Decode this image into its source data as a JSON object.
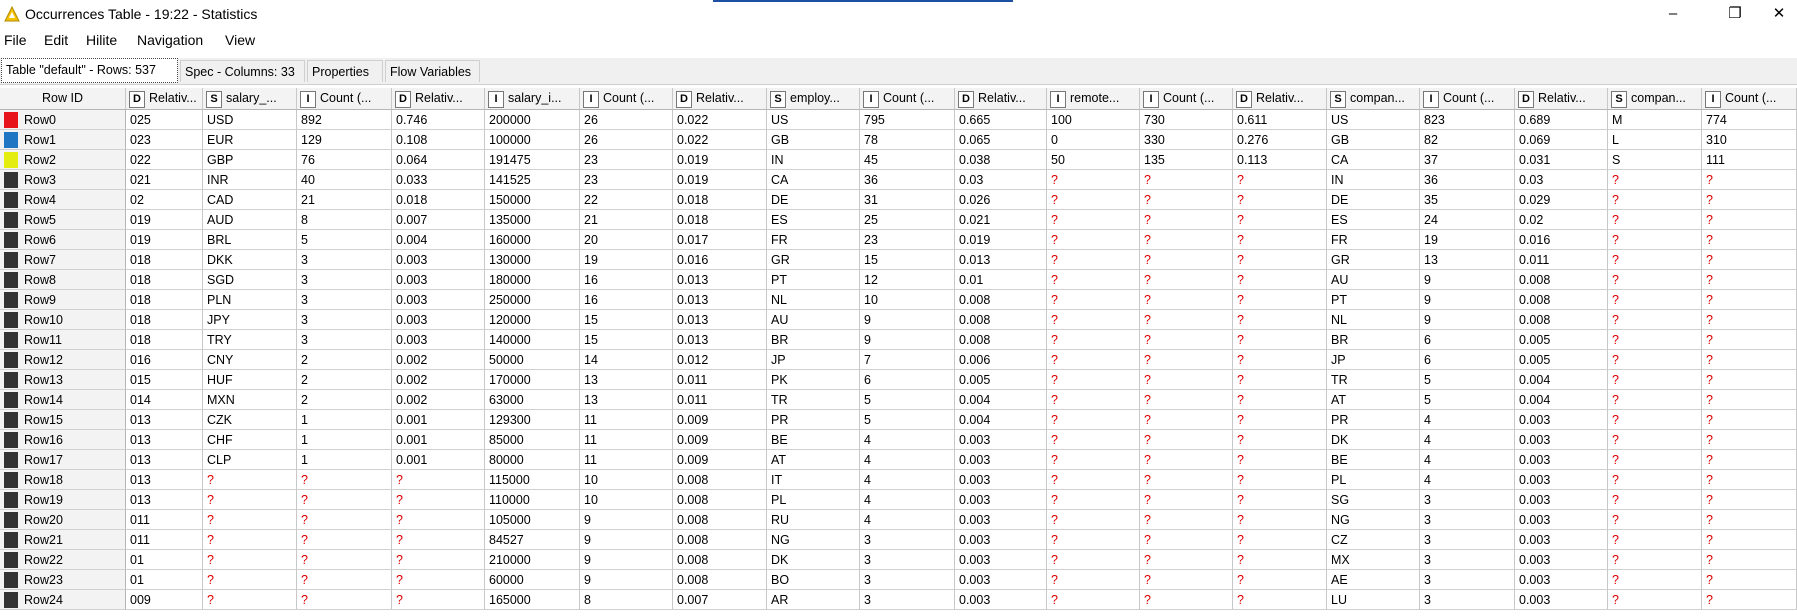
{
  "window": {
    "title": "Occurrences Table - 19:22 - Statistics",
    "minimize": "–",
    "restore": "❐",
    "close": "✕"
  },
  "menu": [
    "File",
    "Edit",
    "Hilite",
    "Navigation",
    "View"
  ],
  "tabs": [
    {
      "label": "Table \"default\" - Rows: 537",
      "active": true
    },
    {
      "label": "Spec - Columns: 33"
    },
    {
      "label": "Properties"
    },
    {
      "label": "Flow Variables"
    }
  ],
  "table": {
    "rowid_header": "Row ID",
    "columns": [
      {
        "type": "D",
        "label": "Relativ..."
      },
      {
        "type": "S",
        "label": "salary_..."
      },
      {
        "type": "I",
        "label": "Count (..."
      },
      {
        "type": "D",
        "label": "Relativ..."
      },
      {
        "type": "I",
        "label": "salary_i..."
      },
      {
        "type": "I",
        "label": "Count (..."
      },
      {
        "type": "D",
        "label": "Relativ..."
      },
      {
        "type": "S",
        "label": "employ..."
      },
      {
        "type": "I",
        "label": "Count (..."
      },
      {
        "type": "D",
        "label": "Relativ..."
      },
      {
        "type": "I",
        "label": "remote..."
      },
      {
        "type": "I",
        "label": "Count (..."
      },
      {
        "type": "D",
        "label": "Relativ..."
      },
      {
        "type": "S",
        "label": "compan..."
      },
      {
        "type": "I",
        "label": "Count (..."
      },
      {
        "type": "D",
        "label": "Relativ..."
      },
      {
        "type": "S",
        "label": "compan..."
      },
      {
        "type": "I",
        "label": "Count (..."
      }
    ],
    "row_colors": [
      "#e8141c",
      "#1f77c4",
      "#e4ed10",
      "#333333",
      "#333333",
      "#333333",
      "#333333",
      "#333333",
      "#333333",
      "#333333",
      "#333333",
      "#333333",
      "#333333",
      "#333333",
      "#333333",
      "#333333",
      "#333333",
      "#333333",
      "#333333",
      "#333333",
      "#333333",
      "#333333",
      "#333333",
      "#333333",
      "#333333"
    ],
    "rows": [
      {
        "id": "Row0",
        "cells": [
          "025",
          "USD",
          "892",
          "0.746",
          "200000",
          "26",
          "0.022",
          "US",
          "795",
          "0.665",
          "100",
          "730",
          "0.611",
          "US",
          "823",
          "0.689",
          "M",
          "774"
        ]
      },
      {
        "id": "Row1",
        "cells": [
          "023",
          "EUR",
          "129",
          "0.108",
          "100000",
          "26",
          "0.022",
          "GB",
          "78",
          "0.065",
          "0",
          "330",
          "0.276",
          "GB",
          "82",
          "0.069",
          "L",
          "310"
        ]
      },
      {
        "id": "Row2",
        "cells": [
          "022",
          "GBP",
          "76",
          "0.064",
          "191475",
          "23",
          "0.019",
          "IN",
          "45",
          "0.038",
          "50",
          "135",
          "0.113",
          "CA",
          "37",
          "0.031",
          "S",
          "111"
        ]
      },
      {
        "id": "Row3",
        "cells": [
          "021",
          "INR",
          "40",
          "0.033",
          "141525",
          "23",
          "0.019",
          "CA",
          "36",
          "0.03",
          "?",
          "?",
          "?",
          "IN",
          "36",
          "0.03",
          "?",
          "?"
        ]
      },
      {
        "id": "Row4",
        "cells": [
          "02",
          "CAD",
          "21",
          "0.018",
          "150000",
          "22",
          "0.018",
          "DE",
          "31",
          "0.026",
          "?",
          "?",
          "?",
          "DE",
          "35",
          "0.029",
          "?",
          "?"
        ]
      },
      {
        "id": "Row5",
        "cells": [
          "019",
          "AUD",
          "8",
          "0.007",
          "135000",
          "21",
          "0.018",
          "ES",
          "25",
          "0.021",
          "?",
          "?",
          "?",
          "ES",
          "24",
          "0.02",
          "?",
          "?"
        ]
      },
      {
        "id": "Row6",
        "cells": [
          "019",
          "BRL",
          "5",
          "0.004",
          "160000",
          "20",
          "0.017",
          "FR",
          "23",
          "0.019",
          "?",
          "?",
          "?",
          "FR",
          "19",
          "0.016",
          "?",
          "?"
        ]
      },
      {
        "id": "Row7",
        "cells": [
          "018",
          "DKK",
          "3",
          "0.003",
          "130000",
          "19",
          "0.016",
          "GR",
          "15",
          "0.013",
          "?",
          "?",
          "?",
          "GR",
          "13",
          "0.011",
          "?",
          "?"
        ]
      },
      {
        "id": "Row8",
        "cells": [
          "018",
          "SGD",
          "3",
          "0.003",
          "180000",
          "16",
          "0.013",
          "PT",
          "12",
          "0.01",
          "?",
          "?",
          "?",
          "AU",
          "9",
          "0.008",
          "?",
          "?"
        ]
      },
      {
        "id": "Row9",
        "cells": [
          "018",
          "PLN",
          "3",
          "0.003",
          "250000",
          "16",
          "0.013",
          "NL",
          "10",
          "0.008",
          "?",
          "?",
          "?",
          "PT",
          "9",
          "0.008",
          "?",
          "?"
        ]
      },
      {
        "id": "Row10",
        "cells": [
          "018",
          "JPY",
          "3",
          "0.003",
          "120000",
          "15",
          "0.013",
          "AU",
          "9",
          "0.008",
          "?",
          "?",
          "?",
          "NL",
          "9",
          "0.008",
          "?",
          "?"
        ]
      },
      {
        "id": "Row11",
        "cells": [
          "018",
          "TRY",
          "3",
          "0.003",
          "140000",
          "15",
          "0.013",
          "BR",
          "9",
          "0.008",
          "?",
          "?",
          "?",
          "BR",
          "6",
          "0.005",
          "?",
          "?"
        ]
      },
      {
        "id": "Row12",
        "cells": [
          "016",
          "CNY",
          "2",
          "0.002",
          "50000",
          "14",
          "0.012",
          "JP",
          "7",
          "0.006",
          "?",
          "?",
          "?",
          "JP",
          "6",
          "0.005",
          "?",
          "?"
        ]
      },
      {
        "id": "Row13",
        "cells": [
          "015",
          "HUF",
          "2",
          "0.002",
          "170000",
          "13",
          "0.011",
          "PK",
          "6",
          "0.005",
          "?",
          "?",
          "?",
          "TR",
          "5",
          "0.004",
          "?",
          "?"
        ]
      },
      {
        "id": "Row14",
        "cells": [
          "014",
          "MXN",
          "2",
          "0.002",
          "63000",
          "13",
          "0.011",
          "TR",
          "5",
          "0.004",
          "?",
          "?",
          "?",
          "AT",
          "5",
          "0.004",
          "?",
          "?"
        ]
      },
      {
        "id": "Row15",
        "cells": [
          "013",
          "CZK",
          "1",
          "0.001",
          "129300",
          "11",
          "0.009",
          "PR",
          "5",
          "0.004",
          "?",
          "?",
          "?",
          "PR",
          "4",
          "0.003",
          "?",
          "?"
        ]
      },
      {
        "id": "Row16",
        "cells": [
          "013",
          "CHF",
          "1",
          "0.001",
          "85000",
          "11",
          "0.009",
          "BE",
          "4",
          "0.003",
          "?",
          "?",
          "?",
          "DK",
          "4",
          "0.003",
          "?",
          "?"
        ]
      },
      {
        "id": "Row17",
        "cells": [
          "013",
          "CLP",
          "1",
          "0.001",
          "80000",
          "11",
          "0.009",
          "AT",
          "4",
          "0.003",
          "?",
          "?",
          "?",
          "BE",
          "4",
          "0.003",
          "?",
          "?"
        ]
      },
      {
        "id": "Row18",
        "cells": [
          "013",
          "?",
          "?",
          "?",
          "115000",
          "10",
          "0.008",
          "IT",
          "4",
          "0.003",
          "?",
          "?",
          "?",
          "PL",
          "4",
          "0.003",
          "?",
          "?"
        ]
      },
      {
        "id": "Row19",
        "cells": [
          "013",
          "?",
          "?",
          "?",
          "110000",
          "10",
          "0.008",
          "PL",
          "4",
          "0.003",
          "?",
          "?",
          "?",
          "SG",
          "3",
          "0.003",
          "?",
          "?"
        ]
      },
      {
        "id": "Row20",
        "cells": [
          "011",
          "?",
          "?",
          "?",
          "105000",
          "9",
          "0.008",
          "RU",
          "4",
          "0.003",
          "?",
          "?",
          "?",
          "NG",
          "3",
          "0.003",
          "?",
          "?"
        ]
      },
      {
        "id": "Row21",
        "cells": [
          "011",
          "?",
          "?",
          "?",
          "84527",
          "9",
          "0.008",
          "NG",
          "3",
          "0.003",
          "?",
          "?",
          "?",
          "CZ",
          "3",
          "0.003",
          "?",
          "?"
        ]
      },
      {
        "id": "Row22",
        "cells": [
          "01",
          "?",
          "?",
          "?",
          "210000",
          "9",
          "0.008",
          "DK",
          "3",
          "0.003",
          "?",
          "?",
          "?",
          "MX",
          "3",
          "0.003",
          "?",
          "?"
        ]
      },
      {
        "id": "Row23",
        "cells": [
          "01",
          "?",
          "?",
          "?",
          "60000",
          "9",
          "0.008",
          "BO",
          "3",
          "0.003",
          "?",
          "?",
          "?",
          "AE",
          "3",
          "0.003",
          "?",
          "?"
        ]
      },
      {
        "id": "Row24",
        "cells": [
          "009",
          "?",
          "?",
          "?",
          "165000",
          "8",
          "0.007",
          "AR",
          "3",
          "0.003",
          "?",
          "?",
          "?",
          "LU",
          "3",
          "0.003",
          "?",
          "?"
        ]
      }
    ]
  }
}
